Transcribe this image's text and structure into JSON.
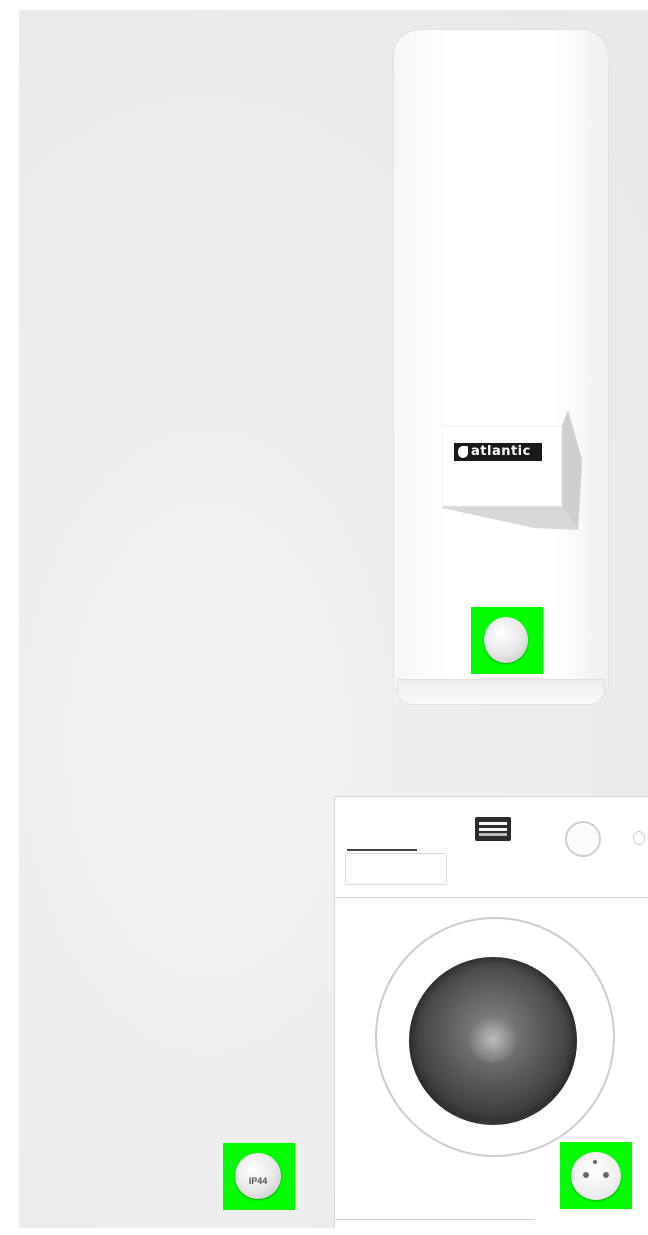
{
  "heater": {
    "brand": "atlantic"
  },
  "wall_socket": {
    "rating": "IP44"
  },
  "hotspots": [
    {
      "name": "heater-control-knob"
    },
    {
      "name": "ip44-socket"
    },
    {
      "name": "washer-power-socket"
    }
  ],
  "colors": {
    "hotspot": "#00ff00",
    "wall": "#ececec"
  }
}
